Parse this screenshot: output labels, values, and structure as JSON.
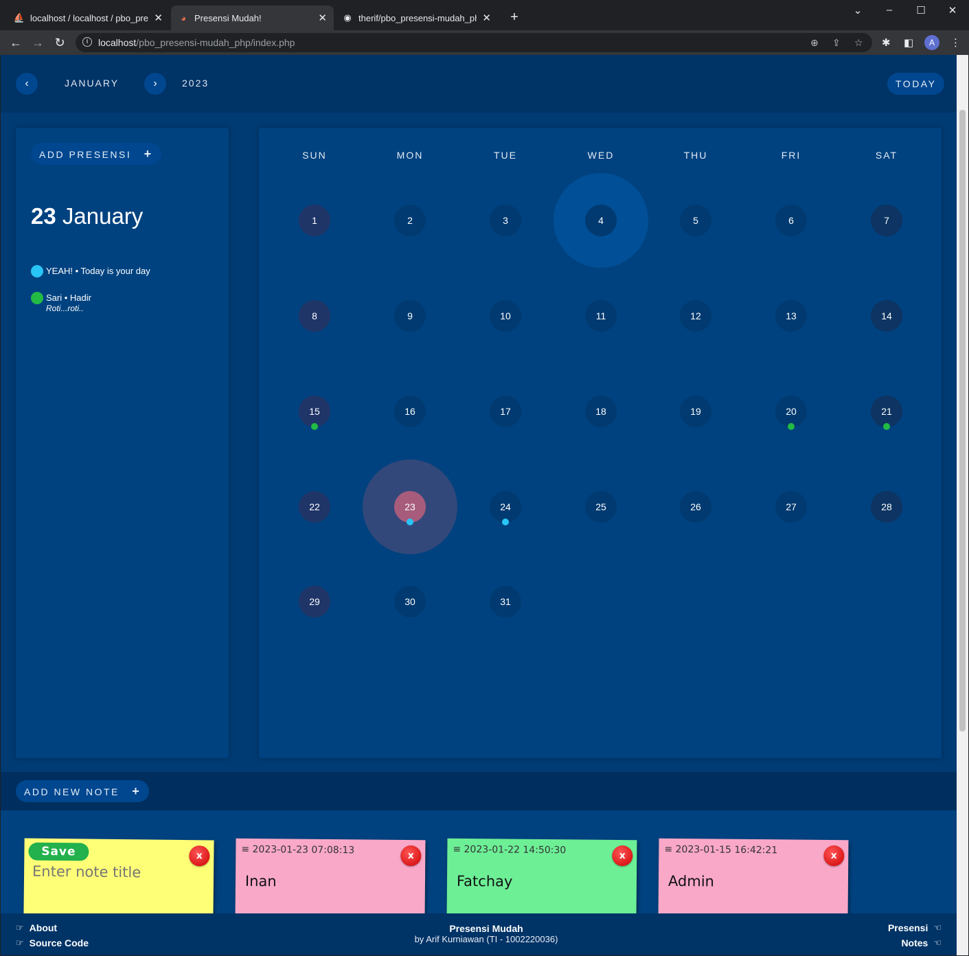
{
  "browser": {
    "tabs": [
      {
        "title": "localhost / localhost / pbo_prese",
        "icon": "phpmyadmin-icon",
        "active": false
      },
      {
        "title": "Presensi Mudah!",
        "icon": "app-icon",
        "active": true
      },
      {
        "title": "therif/pbo_presensi-mudah_php:",
        "icon": "github-icon",
        "active": false
      }
    ],
    "url_host": "localhost",
    "url_path": "/pbo_presensi-mudah_php/index.php",
    "avatar_letter": "A"
  },
  "header": {
    "month": "JANUARY",
    "year": "2023",
    "prev_label": "‹",
    "next_label": "›",
    "today_label": "TODAY"
  },
  "sidebar": {
    "add_label": "ADD PRESENSI",
    "add_icon": "+",
    "date_day": "23",
    "date_month": "January",
    "events": [
      {
        "text": "YEAH! • Today is your day",
        "sub": "",
        "color": "#29c5f6"
      },
      {
        "text": "Sari • Hadir",
        "sub": "Roti...roti..",
        "color": "#22bb44"
      }
    ]
  },
  "calendar": {
    "weekdays": [
      "SUN",
      "MON",
      "TUE",
      "WED",
      "THU",
      "FRI",
      "SAT"
    ],
    "days": [
      "1",
      "2",
      "3",
      "4",
      "5",
      "6",
      "7",
      "8",
      "9",
      "10",
      "11",
      "12",
      "13",
      "14",
      "15",
      "16",
      "17",
      "18",
      "19",
      "20",
      "21",
      "22",
      "23",
      "24",
      "25",
      "26",
      "27",
      "28",
      "29",
      "30",
      "31"
    ],
    "start_weekday": 0,
    "selected_day": 4,
    "today_day": 23,
    "markers": [
      {
        "day": 15,
        "color": "#22bb44"
      },
      {
        "day": 20,
        "color": "#22bb44"
      },
      {
        "day": 21,
        "color": "#22bb44"
      },
      {
        "day": 23,
        "color": "#29c5f6"
      },
      {
        "day": 24,
        "color": "#29c5f6"
      }
    ]
  },
  "notes": {
    "add_label": "ADD NEW NOTE",
    "add_icon": "+",
    "new_note": {
      "save_label": "Save",
      "placeholder": "Enter note title",
      "color": "#ffff77"
    },
    "items": [
      {
        "stamp": "2023-01-23 07:08:13",
        "title": "Inan",
        "color": "#f9a8c8"
      },
      {
        "stamp": "2023-01-22 14:50:30",
        "title": "Fatchay",
        "color": "#6def96"
      },
      {
        "stamp": "2023-01-15 16:42:21",
        "title": "Admin",
        "color": "#f9a8c8"
      }
    ],
    "delete_label": "x",
    "handle_icon": "≡"
  },
  "footer": {
    "about": "About",
    "source": "Source Code",
    "title": "Presensi Mudah",
    "subtitle": "by Arif Kurniawan (TI - 1002220036)",
    "presensi": "Presensi",
    "notes": "Notes"
  }
}
